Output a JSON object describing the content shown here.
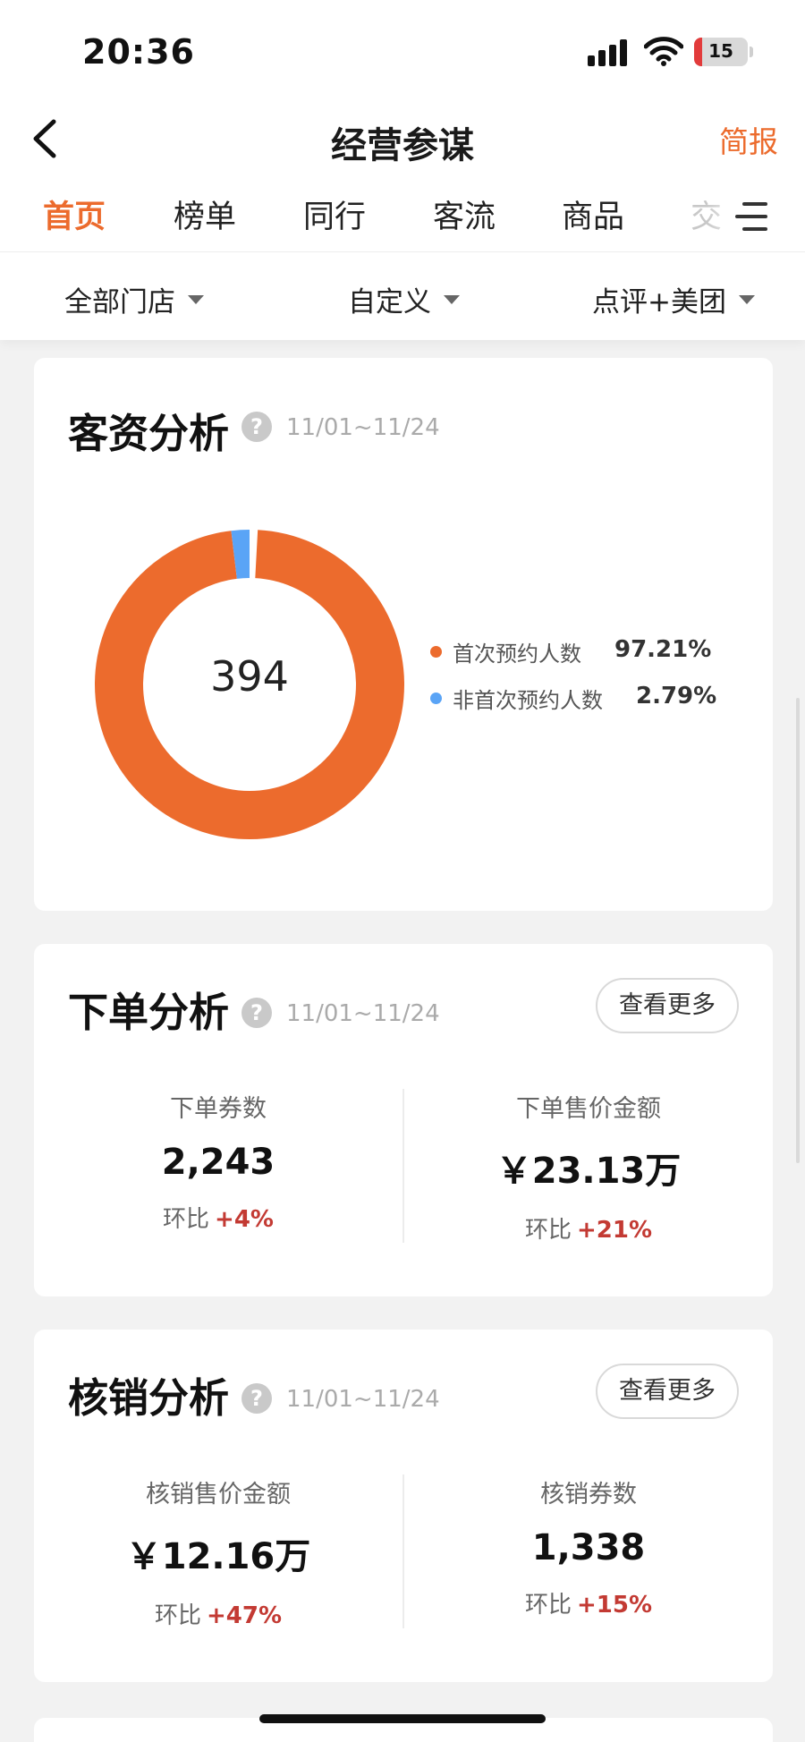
{
  "status_bar": {
    "time": "20:36",
    "battery": "15"
  },
  "nav": {
    "title": "经营参谋",
    "report": "简报"
  },
  "tabs": [
    {
      "label": "首页",
      "active": true
    },
    {
      "label": "榜单",
      "active": false
    },
    {
      "label": "同行",
      "active": false
    },
    {
      "label": "客流",
      "active": false
    },
    {
      "label": "商品",
      "active": false
    },
    {
      "label": "交",
      "active": false
    }
  ],
  "filters": {
    "store": "全部门店",
    "period": "自定义",
    "platform": "点评+美团"
  },
  "customer_card": {
    "title": "客资分析",
    "date_range": "11/01~11/24",
    "total": "394",
    "legend": [
      {
        "label": "首次预约人数",
        "pct": "97.21%",
        "value": 97.21,
        "color": "#ec6b2d"
      },
      {
        "label": "非首次预约人数",
        "pct": "2.79%",
        "value": 2.79,
        "color": "#5aa4f6"
      }
    ]
  },
  "order_card": {
    "title": "下单分析",
    "date_range": "11/01~11/24",
    "more": "查看更多",
    "stats": [
      {
        "label": "下单券数",
        "value": "2,243",
        "change_label": "环比",
        "change": "+4%"
      },
      {
        "label": "下单售价金额",
        "value": "￥23.13万",
        "change_label": "环比",
        "change": "+21%"
      }
    ]
  },
  "verify_card": {
    "title": "核销分析",
    "date_range": "11/01~11/24",
    "more": "查看更多",
    "stats": [
      {
        "label": "核销售价金额",
        "value": "￥12.16万",
        "change_label": "环比",
        "change": "+47%"
      },
      {
        "label": "核销券数",
        "value": "1,338",
        "change_label": "环比",
        "change": "+15%"
      }
    ]
  },
  "colors": {
    "accent": "#ec6b2d",
    "secondary": "#5aa4f6",
    "increase": "#c33a33"
  }
}
